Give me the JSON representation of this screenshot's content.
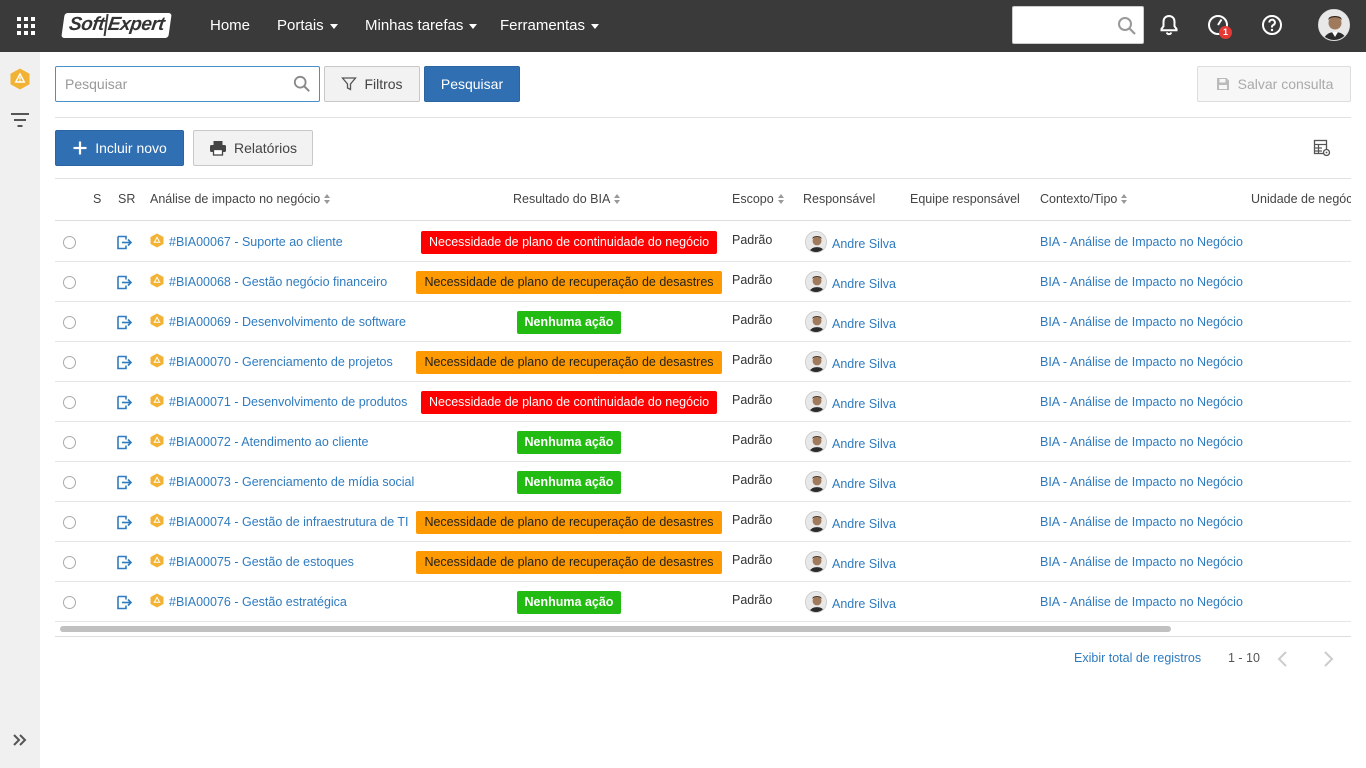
{
  "topbar": {
    "logo_left": "Soft",
    "logo_right": "Expert",
    "nav": [
      "Home",
      "Portais",
      "Minhas tarefas",
      "Ferramentas"
    ],
    "notification_count": "1"
  },
  "toolbar": {
    "search_placeholder": "Pesquisar",
    "filters_label": "Filtros",
    "search_button": "Pesquisar",
    "save_query_label": "Salvar consulta",
    "new_label": "Incluir novo",
    "reports_label": "Relatórios"
  },
  "table": {
    "headers": {
      "s": "S",
      "sr": "SR",
      "analysis": "Análise de impacto no negócio",
      "result": "Resultado do BIA",
      "scope": "Escopo",
      "owner": "Responsável",
      "team": "Equipe responsável",
      "context": "Contexto/Tipo",
      "unit": "Unidade de negócio"
    },
    "rows": [
      {
        "title": "#BIA00067 - Suporte ao cliente",
        "result": "Necessidade de plano de continuidade do negócio",
        "status": "red",
        "scope": "Padrão",
        "owner": "Andre Silva",
        "context": "BIA - Análise de Impacto no Negócio"
      },
      {
        "title": "#BIA00068 - Gestão negócio financeiro",
        "result": "Necessidade de plano de recuperação de desastres",
        "status": "orange",
        "scope": "Padrão",
        "owner": "Andre Silva",
        "context": "BIA - Análise de Impacto no Negócio"
      },
      {
        "title": "#BIA00069 - Desenvolvimento de software",
        "result": "Nenhuma ação",
        "status": "green",
        "scope": "Padrão",
        "owner": "Andre Silva",
        "context": "BIA - Análise de Impacto no Negócio"
      },
      {
        "title": "#BIA00070 - Gerenciamento de projetos",
        "result": "Necessidade de plano de recuperação de desastres",
        "status": "orange",
        "scope": "Padrão",
        "owner": "Andre Silva",
        "context": "BIA - Análise de Impacto no Negócio"
      },
      {
        "title": "#BIA00071 - Desenvolvimento de produtos",
        "result": "Necessidade de plano de continuidade do negócio",
        "status": "red",
        "scope": "Padrão",
        "owner": "Andre Silva",
        "context": "BIA - Análise de Impacto no Negócio"
      },
      {
        "title": "#BIA00072 - Atendimento ao cliente",
        "result": "Nenhuma ação",
        "status": "green",
        "scope": "Padrão",
        "owner": "Andre Silva",
        "context": "BIA - Análise de Impacto no Negócio"
      },
      {
        "title": "#BIA00073 - Gerenciamento de mídia social",
        "result": "Nenhuma ação",
        "status": "green",
        "scope": "Padrão",
        "owner": "Andre Silva",
        "context": "BIA - Análise de Impacto no Negócio"
      },
      {
        "title": "#BIA00074 - Gestão de infraestrutura de TI",
        "result": "Necessidade de plano de recuperação de desastres",
        "status": "orange",
        "scope": "Padrão",
        "owner": "Andre Silva",
        "context": "BIA - Análise de Impacto no Negócio"
      },
      {
        "title": "#BIA00075 - Gestão de estoques",
        "result": "Necessidade de plano de recuperação de desastres",
        "status": "orange",
        "scope": "Padrão",
        "owner": "Andre Silva",
        "context": "BIA - Análise de Impacto no Negócio"
      },
      {
        "title": "#BIA00076 - Gestão estratégica",
        "result": "Nenhuma ação",
        "status": "green",
        "scope": "Padrão",
        "owner": "Andre Silva",
        "context": "BIA - Análise de Impacto no Negócio"
      }
    ]
  },
  "footer": {
    "show_total": "Exibir total de registros",
    "range": "1 - 10"
  },
  "colors": {
    "topbar": "#3a3a3a",
    "primary": "#2f6fb2",
    "link": "#2f7bbf",
    "red": "#ff0000",
    "orange": "#ff9900",
    "green": "#22bb11"
  }
}
